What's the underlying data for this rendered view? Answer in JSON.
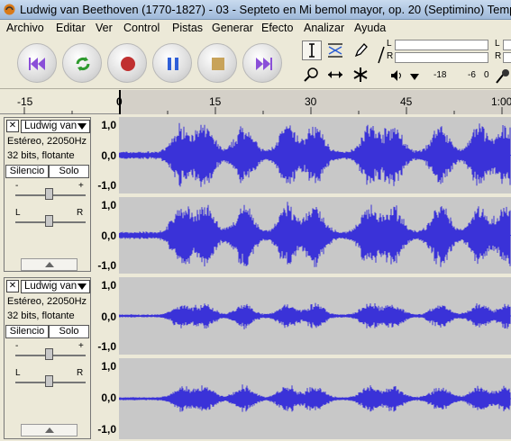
{
  "window": {
    "title": "Ludwig van Beethoven (1770-1827) - 03 - Septeto en Mi bemol mayor, op. 20 (Septimino) Tempo de Me"
  },
  "menu": [
    "Archivo",
    "Editar",
    "Ver",
    "Control",
    "Pistas",
    "Generar",
    "Efecto",
    "Analizar",
    "Ayuda"
  ],
  "transport": {
    "buttons": [
      "skip-start",
      "loop",
      "record",
      "pause",
      "stop",
      "skip-end"
    ]
  },
  "meters": {
    "left": "L",
    "right": "R",
    "db_labels": [
      "-18",
      "-6",
      "0"
    ],
    "db_labels_top": [
      "L",
      "R"
    ]
  },
  "ruler": {
    "labels": [
      "-15",
      "0",
      "15",
      "30",
      "45",
      "1:00"
    ]
  },
  "tracks": [
    {
      "name": "Ludwig van",
      "info1": "Estéreo, 22050Hz",
      "info2": "32 bits, flotante",
      "mute": "Silencio",
      "solo": "Solo",
      "gain_min": "-",
      "gain_max": "+",
      "pan_left": "L",
      "pan_right": "R",
      "channels": [
        {
          "top": "1,0",
          "mid": "0,0",
          "bot": "-1,0"
        },
        {
          "top": "1,0",
          "mid": "0,0",
          "bot": "-1,0"
        }
      ]
    },
    {
      "name": "Ludwig van",
      "info1": "Estéreo, 22050Hz",
      "info2": "32 bits, flotante",
      "mute": "Silencio",
      "solo": "Solo",
      "gain_min": "-",
      "gain_max": "+",
      "pan_left": "L",
      "pan_right": "R",
      "channels": [
        {
          "top": "1,0",
          "mid": "0,0",
          "bot": "-1,0"
        },
        {
          "top": "1,0",
          "mid": "0,0",
          "bot": "-1,0"
        }
      ]
    }
  ],
  "colors": {
    "waveform": "#3a32d8",
    "wave_bg": "#c8c8c8",
    "title_bg": "#b5cbe7"
  }
}
